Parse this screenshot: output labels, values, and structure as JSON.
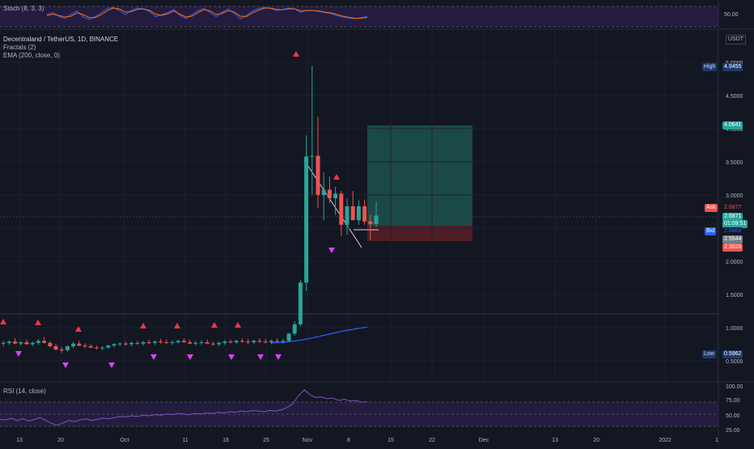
{
  "panels": {
    "stoch": {
      "label": "Stoch (8, 3, 3)",
      "tick_label": "50.00"
    },
    "main": {
      "symbol_line": "Decentraland / TetherUS, 1D, BINANCE",
      "indicator_1": "Fractals (2)",
      "indicator_2": "EMA (200, close, 0)",
      "currency_button": "USDT"
    },
    "rsi": {
      "label": "RSI (14, close)",
      "tick_labels": [
        "100.00",
        "75.00",
        "50.00",
        "25.00"
      ]
    }
  },
  "price_tags": {
    "high_label": "High",
    "high_value": "4.9455",
    "target_value": "4.0641",
    "ask_label": "Ask",
    "ask_value": "2.6877",
    "last_value": "2.6871",
    "countdown": "01:09:51",
    "bid_label": "Bid",
    "bid_value": "2.6869",
    "entry_value": "2.5544",
    "stop_value": "2.3028",
    "low_label": "Low",
    "low_value": "0.5962"
  },
  "colors": {
    "background": "#131722",
    "up": "#26a69a",
    "down": "#ef5350",
    "ema": "#2962ff",
    "stoch_k": "#2962ff",
    "stoch_d": "#ff6d00",
    "rsi_line": "#7e57c2",
    "fractal_up": "#f23645",
    "fractal_down": "#e040fb",
    "target_zone": "#1e5b55",
    "stop_zone": "#5a1f26"
  },
  "chart_data": {
    "type": "candlestick",
    "title": "Decentraland / TetherUS, 1D, BINANCE",
    "y_axis_ticks": [
      "5.0000",
      "4.5000",
      "4.0000",
      "3.5000",
      "3.0000",
      "2.5000",
      "2.0000",
      "1.5000",
      "1.0000",
      "0.5000"
    ],
    "x_axis_ticks": [
      "13",
      "20",
      "Oct",
      "11",
      "18",
      "25",
      "Nov",
      "8",
      "15",
      "22",
      "Dec",
      "13",
      "20",
      "2022",
      "1"
    ],
    "ylim": [
      0.42,
      5.05
    ],
    "candles": [
      {
        "o": 0.78,
        "h": 0.83,
        "l": 0.73,
        "c": 0.76
      },
      {
        "o": 0.76,
        "h": 0.8,
        "l": 0.72,
        "c": 0.77
      },
      {
        "o": 0.77,
        "h": 0.81,
        "l": 0.74,
        "c": 0.79
      },
      {
        "o": 0.79,
        "h": 0.84,
        "l": 0.75,
        "c": 0.76
      },
      {
        "o": 0.76,
        "h": 0.8,
        "l": 0.73,
        "c": 0.78
      },
      {
        "o": 0.78,
        "h": 0.82,
        "l": 0.74,
        "c": 0.75
      },
      {
        "o": 0.75,
        "h": 0.79,
        "l": 0.72,
        "c": 0.77
      },
      {
        "o": 0.77,
        "h": 0.83,
        "l": 0.74,
        "c": 0.8
      },
      {
        "o": 0.8,
        "h": 0.86,
        "l": 0.76,
        "c": 0.77
      },
      {
        "o": 0.77,
        "h": 0.8,
        "l": 0.7,
        "c": 0.72
      },
      {
        "o": 0.72,
        "h": 0.76,
        "l": 0.66,
        "c": 0.67
      },
      {
        "o": 0.67,
        "h": 0.71,
        "l": 0.62,
        "c": 0.66
      },
      {
        "o": 0.66,
        "h": 0.73,
        "l": 0.64,
        "c": 0.72
      },
      {
        "o": 0.72,
        "h": 0.79,
        "l": 0.69,
        "c": 0.76
      },
      {
        "o": 0.76,
        "h": 0.8,
        "l": 0.72,
        "c": 0.73
      },
      {
        "o": 0.73,
        "h": 0.76,
        "l": 0.69,
        "c": 0.72
      },
      {
        "o": 0.72,
        "h": 0.75,
        "l": 0.69,
        "c": 0.7
      },
      {
        "o": 0.7,
        "h": 0.73,
        "l": 0.67,
        "c": 0.69
      },
      {
        "o": 0.69,
        "h": 0.72,
        "l": 0.66,
        "c": 0.7
      },
      {
        "o": 0.7,
        "h": 0.74,
        "l": 0.68,
        "c": 0.73
      },
      {
        "o": 0.73,
        "h": 0.77,
        "l": 0.7,
        "c": 0.75
      },
      {
        "o": 0.75,
        "h": 0.78,
        "l": 0.72,
        "c": 0.76
      },
      {
        "o": 0.76,
        "h": 0.79,
        "l": 0.73,
        "c": 0.75
      },
      {
        "o": 0.75,
        "h": 0.79,
        "l": 0.72,
        "c": 0.77
      },
      {
        "o": 0.77,
        "h": 0.8,
        "l": 0.74,
        "c": 0.76
      },
      {
        "o": 0.76,
        "h": 0.8,
        "l": 0.73,
        "c": 0.78
      },
      {
        "o": 0.78,
        "h": 0.82,
        "l": 0.75,
        "c": 0.77
      },
      {
        "o": 0.77,
        "h": 0.81,
        "l": 0.74,
        "c": 0.79
      },
      {
        "o": 0.79,
        "h": 0.83,
        "l": 0.76,
        "c": 0.78
      },
      {
        "o": 0.78,
        "h": 0.82,
        "l": 0.75,
        "c": 0.77
      },
      {
        "o": 0.77,
        "h": 0.81,
        "l": 0.74,
        "c": 0.78
      },
      {
        "o": 0.78,
        "h": 0.82,
        "l": 0.76,
        "c": 0.8
      },
      {
        "o": 0.8,
        "h": 0.84,
        "l": 0.77,
        "c": 0.78
      },
      {
        "o": 0.78,
        "h": 0.82,
        "l": 0.75,
        "c": 0.76
      },
      {
        "o": 0.76,
        "h": 0.8,
        "l": 0.73,
        "c": 0.77
      },
      {
        "o": 0.77,
        "h": 0.81,
        "l": 0.74,
        "c": 0.78
      },
      {
        "o": 0.78,
        "h": 0.82,
        "l": 0.75,
        "c": 0.76
      },
      {
        "o": 0.76,
        "h": 0.79,
        "l": 0.73,
        "c": 0.75
      },
      {
        "o": 0.75,
        "h": 0.79,
        "l": 0.72,
        "c": 0.77
      },
      {
        "o": 0.77,
        "h": 0.81,
        "l": 0.74,
        "c": 0.79
      },
      {
        "o": 0.79,
        "h": 0.82,
        "l": 0.76,
        "c": 0.78
      },
      {
        "o": 0.78,
        "h": 0.82,
        "l": 0.75,
        "c": 0.8
      },
      {
        "o": 0.8,
        "h": 0.84,
        "l": 0.77,
        "c": 0.79
      },
      {
        "o": 0.79,
        "h": 0.83,
        "l": 0.75,
        "c": 0.78
      },
      {
        "o": 0.78,
        "h": 0.82,
        "l": 0.75,
        "c": 0.8
      },
      {
        "o": 0.8,
        "h": 0.84,
        "l": 0.77,
        "c": 0.79
      },
      {
        "o": 0.79,
        "h": 0.83,
        "l": 0.76,
        "c": 0.78
      },
      {
        "o": 0.78,
        "h": 0.82,
        "l": 0.75,
        "c": 0.8
      },
      {
        "o": 0.8,
        "h": 0.84,
        "l": 0.77,
        "c": 0.79
      },
      {
        "o": 0.79,
        "h": 0.83,
        "l": 0.76,
        "c": 0.8
      },
      {
        "o": 0.8,
        "h": 0.92,
        "l": 0.78,
        "c": 0.91
      },
      {
        "o": 0.91,
        "h": 1.1,
        "l": 0.88,
        "c": 1.05
      },
      {
        "o": 1.05,
        "h": 1.72,
        "l": 1.02,
        "c": 1.68
      },
      {
        "o": 1.68,
        "h": 3.9,
        "l": 1.55,
        "c": 3.58
      },
      {
        "o": 3.58,
        "h": 4.95,
        "l": 3.0,
        "c": 3.59
      },
      {
        "o": 3.59,
        "h": 4.18,
        "l": 2.8,
        "c": 3.0
      },
      {
        "o": 3.0,
        "h": 3.34,
        "l": 2.62,
        "c": 3.08
      },
      {
        "o": 3.08,
        "h": 3.28,
        "l": 2.88,
        "c": 2.95
      },
      {
        "o": 2.95,
        "h": 3.12,
        "l": 2.7,
        "c": 3.02
      },
      {
        "o": 3.02,
        "h": 3.06,
        "l": 2.38,
        "c": 2.55
      },
      {
        "o": 2.55,
        "h": 2.95,
        "l": 2.4,
        "c": 2.83
      },
      {
        "o": 2.83,
        "h": 3.06,
        "l": 2.62,
        "c": 2.62
      },
      {
        "o": 2.62,
        "h": 2.92,
        "l": 2.55,
        "c": 2.83
      },
      {
        "o": 2.83,
        "h": 2.93,
        "l": 2.55,
        "c": 2.6
      },
      {
        "o": 2.6,
        "h": 2.7,
        "l": 2.32,
        "c": 2.56
      },
      {
        "o": 2.56,
        "h": 2.9,
        "l": 2.52,
        "c": 2.69
      }
    ],
    "ema": [
      0.77,
      0.78,
      0.8,
      0.83,
      0.87,
      0.91,
      0.95,
      0.98,
      1.01
    ],
    "position": {
      "target": 4.0641,
      "entry": 2.5544,
      "stop": 2.3028
    },
    "rsi": [
      42,
      41,
      44,
      40,
      43,
      39,
      42,
      45,
      40,
      35,
      32,
      36,
      40,
      38,
      41,
      43,
      40,
      42,
      44,
      43,
      45,
      47,
      46,
      48,
      47,
      49,
      48,
      50,
      49,
      51,
      50,
      52,
      51,
      50,
      52,
      51,
      53,
      52,
      54,
      53,
      55,
      54,
      56,
      55,
      57,
      56,
      55,
      57,
      56,
      58,
      62,
      68,
      82,
      92,
      84,
      79,
      80,
      77,
      78,
      74,
      76,
      73,
      74,
      71,
      72
    ],
    "stoch_k": [
      60,
      70,
      50,
      40,
      62,
      78,
      48,
      35,
      50,
      70,
      90,
      95,
      80,
      60,
      82,
      92,
      88,
      75,
      50,
      60,
      70,
      85,
      55,
      40,
      60,
      80,
      90,
      70,
      50,
      72,
      88,
      65,
      40,
      55,
      78,
      90,
      95,
      90,
      80,
      85,
      92,
      88,
      70,
      82,
      80,
      75,
      70,
      65,
      55,
      48,
      42,
      40,
      45,
      50
    ],
    "stoch_d": [
      55,
      62,
      55,
      48,
      52,
      68,
      60,
      45,
      45,
      60,
      80,
      92,
      88,
      72,
      75,
      86,
      88,
      80,
      62,
      56,
      64,
      78,
      62,
      48,
      52,
      70,
      85,
      78,
      60,
      66,
      80,
      72,
      52,
      50,
      68,
      82,
      92,
      92,
      86,
      84,
      88,
      88,
      78,
      80,
      80,
      78,
      72,
      68,
      60,
      52,
      46,
      42,
      42,
      46
    ]
  }
}
